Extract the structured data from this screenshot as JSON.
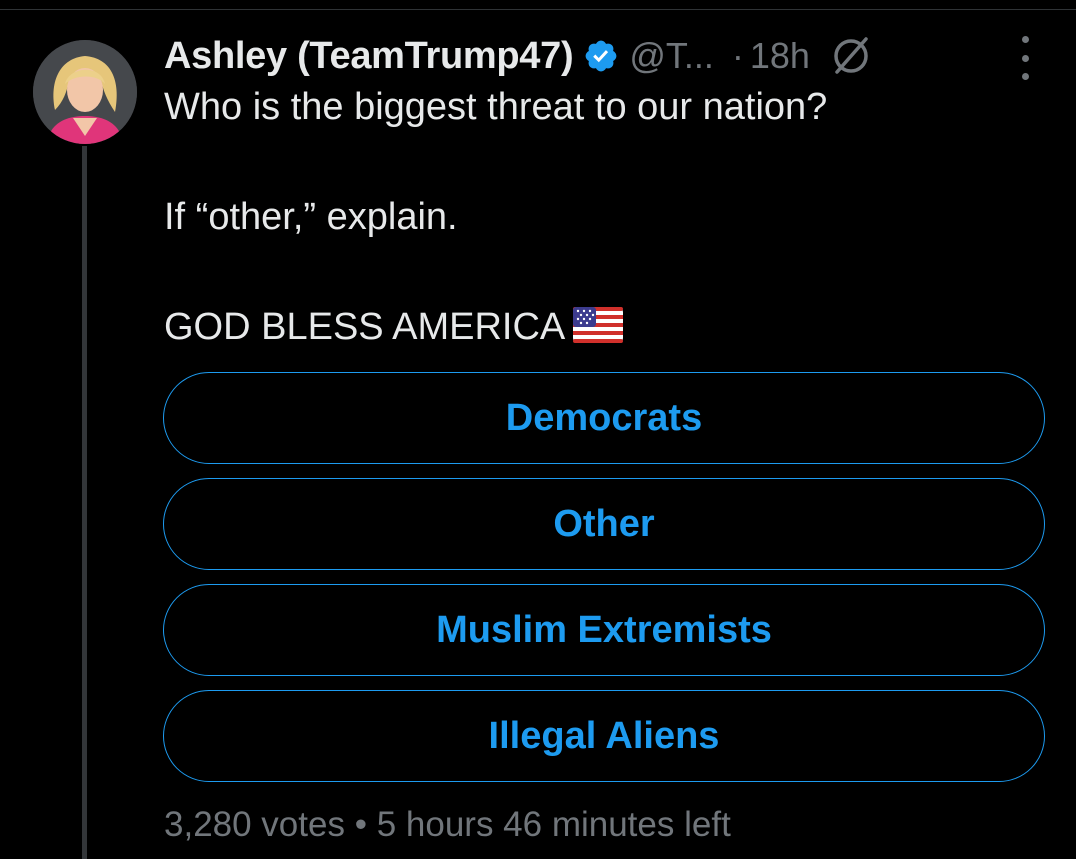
{
  "post": {
    "display_name": "Ashley (TeamTrump47)",
    "handle": "@T...",
    "separator": "·",
    "time": "18h",
    "line1": "Who is the biggest threat to our nation?",
    "line2": "If “other,” explain.",
    "line3": "GOD BLESS AMERICA",
    "icons": {
      "verified": "verified-badge-icon",
      "edited": "edited-icon",
      "more": "more-options-icon",
      "flag": "us-flag-emoji-icon"
    }
  },
  "poll": {
    "options": [
      {
        "label": "Democrats"
      },
      {
        "label": "Other"
      },
      {
        "label": "Muslim Extremists"
      },
      {
        "label": "Illegal Aliens"
      }
    ],
    "votes": "3,280 votes",
    "bullet": "•",
    "time_left": "5 hours 46 minutes left"
  },
  "colors": {
    "background": "#000000",
    "text_primary": "#e7e9ea",
    "text_secondary": "#71767b",
    "accent": "#1d9bf0"
  }
}
